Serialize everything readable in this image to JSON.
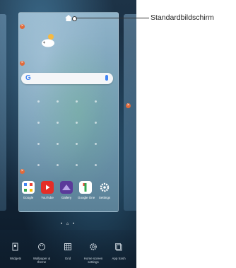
{
  "callout": {
    "label": "Standardbildschirm"
  },
  "apps": [
    {
      "name": "google",
      "label": "Google",
      "color": "#ffffff"
    },
    {
      "name": "youtube",
      "label": "YouTube",
      "color": "#e52d27"
    },
    {
      "name": "gallery",
      "label": "Gallery",
      "color": "#5a3a9a"
    },
    {
      "name": "google-one",
      "label": "Google One",
      "color": "#ffffff"
    },
    {
      "name": "settings",
      "label": "Settings",
      "color": "#2b3e50"
    }
  ],
  "page_indicator": {
    "text": "• ⌂ •"
  },
  "tools": [
    {
      "name": "widgets",
      "label": "Widgets"
    },
    {
      "name": "wallpaper-theme",
      "label": "Wallpaper & theme"
    },
    {
      "name": "grid",
      "label": "Grid"
    },
    {
      "name": "home-screen-settings",
      "label": "Home screen settings"
    },
    {
      "name": "app-trash",
      "label": "App trash"
    }
  ],
  "colors": {
    "remove_badge": "#e06a3a",
    "search_accent": "#4285f4"
  }
}
